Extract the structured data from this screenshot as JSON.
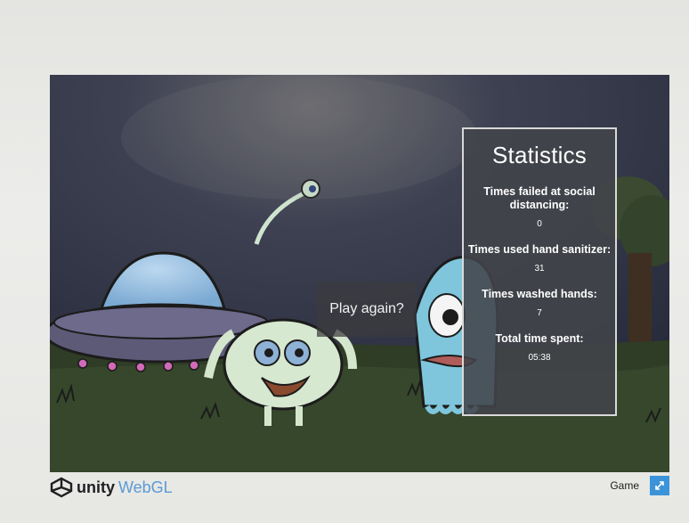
{
  "stats": {
    "title": "Statistics",
    "items": [
      {
        "label": "Times failed at social distancing:",
        "value": "0"
      },
      {
        "label": "Times used hand sanitizer:",
        "value": "31"
      },
      {
        "label": "Times washed hands:",
        "value": "7"
      },
      {
        "label": "Total time spent:",
        "value": "05:38"
      }
    ]
  },
  "play_again_label": "Play again?",
  "footer": {
    "unity_text": "unity",
    "webgl_text": "WebGL",
    "game_label": "Game",
    "fullscreen_icon": "fullscreen-icon"
  },
  "colors": {
    "accent": "#3b94d9",
    "webgl_blue": "#5b9bd5"
  }
}
